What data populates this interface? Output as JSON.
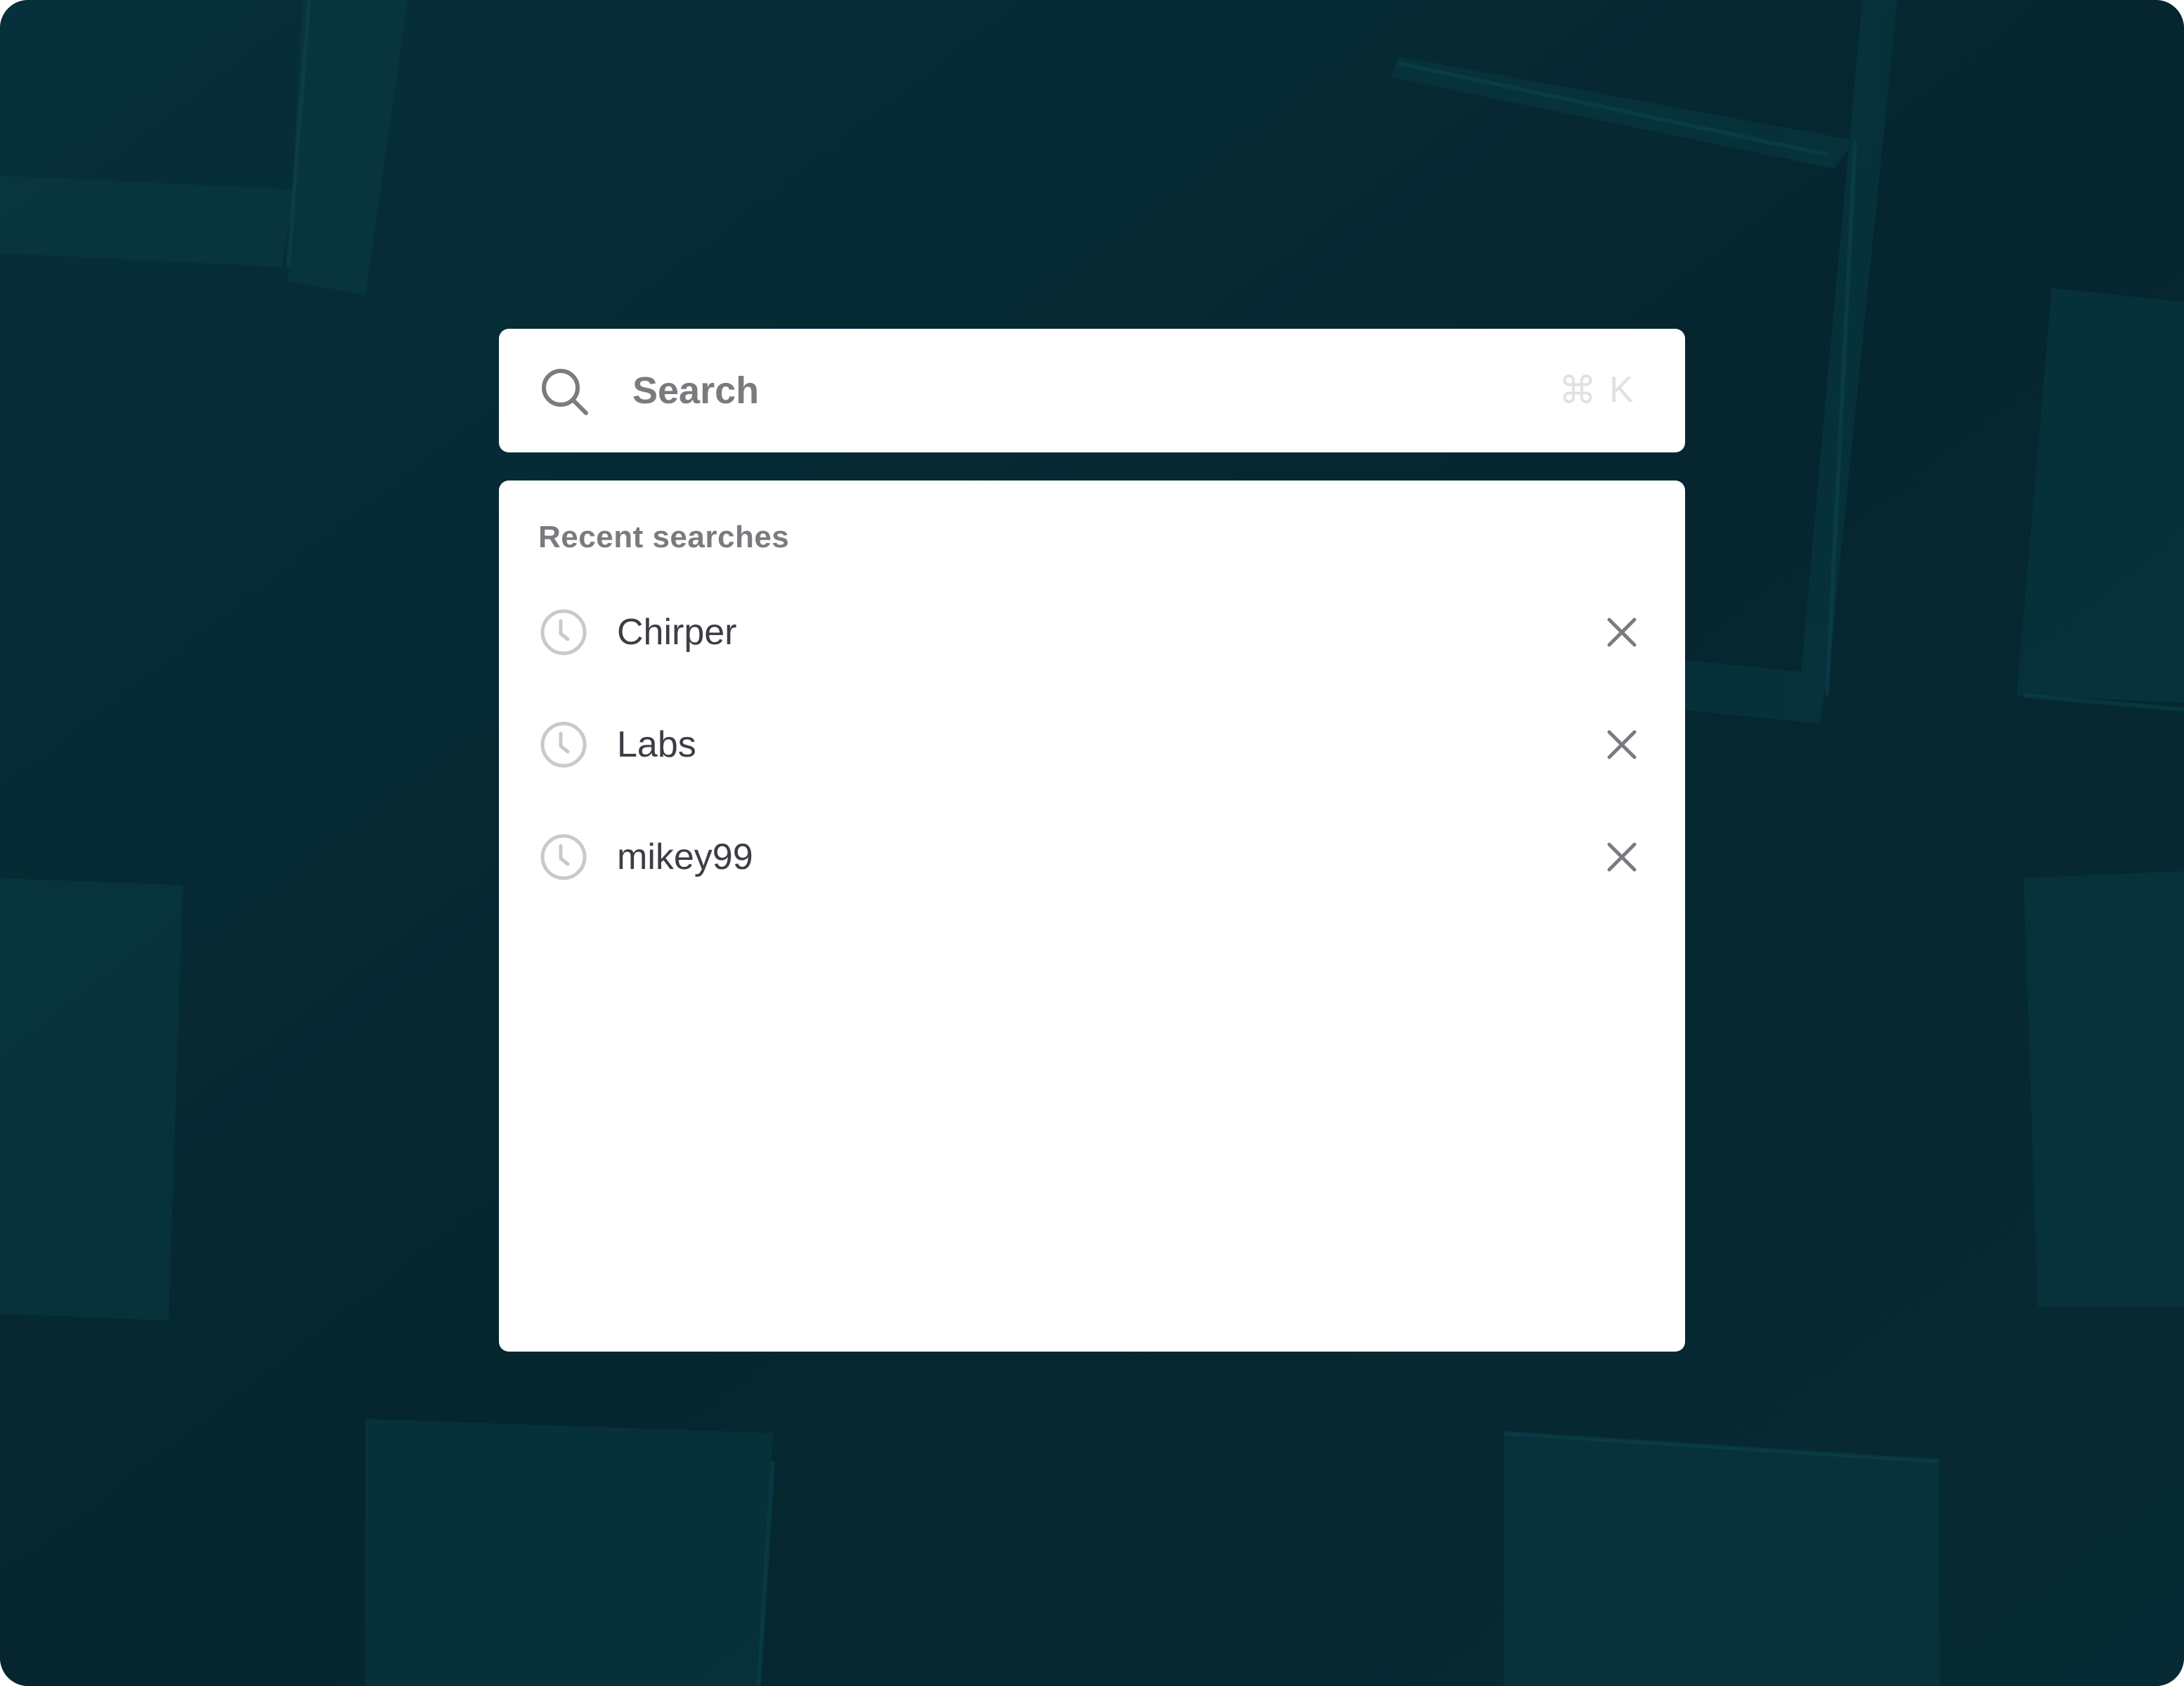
{
  "search": {
    "placeholder": "Search",
    "value": "",
    "shortcut": {
      "modifier": "⌘",
      "key": "K"
    }
  },
  "recent": {
    "title": "Recent searches",
    "items": [
      {
        "label": "Chirper",
        "icon": "clock-icon",
        "action_icon": "close-icon"
      },
      {
        "label": "Labs",
        "icon": "clock-icon",
        "action_icon": "close-icon"
      },
      {
        "label": "mikey99",
        "icon": "clock-icon",
        "action_icon": "close-icon"
      }
    ]
  },
  "colors": {
    "background": "#06262f",
    "panel": "#ffffff",
    "muted_text": "#7b7a7f",
    "item_text": "#3e3c44",
    "icon_gray": "#c9c8cc",
    "shortcut_gray": "#e1e1e4"
  }
}
